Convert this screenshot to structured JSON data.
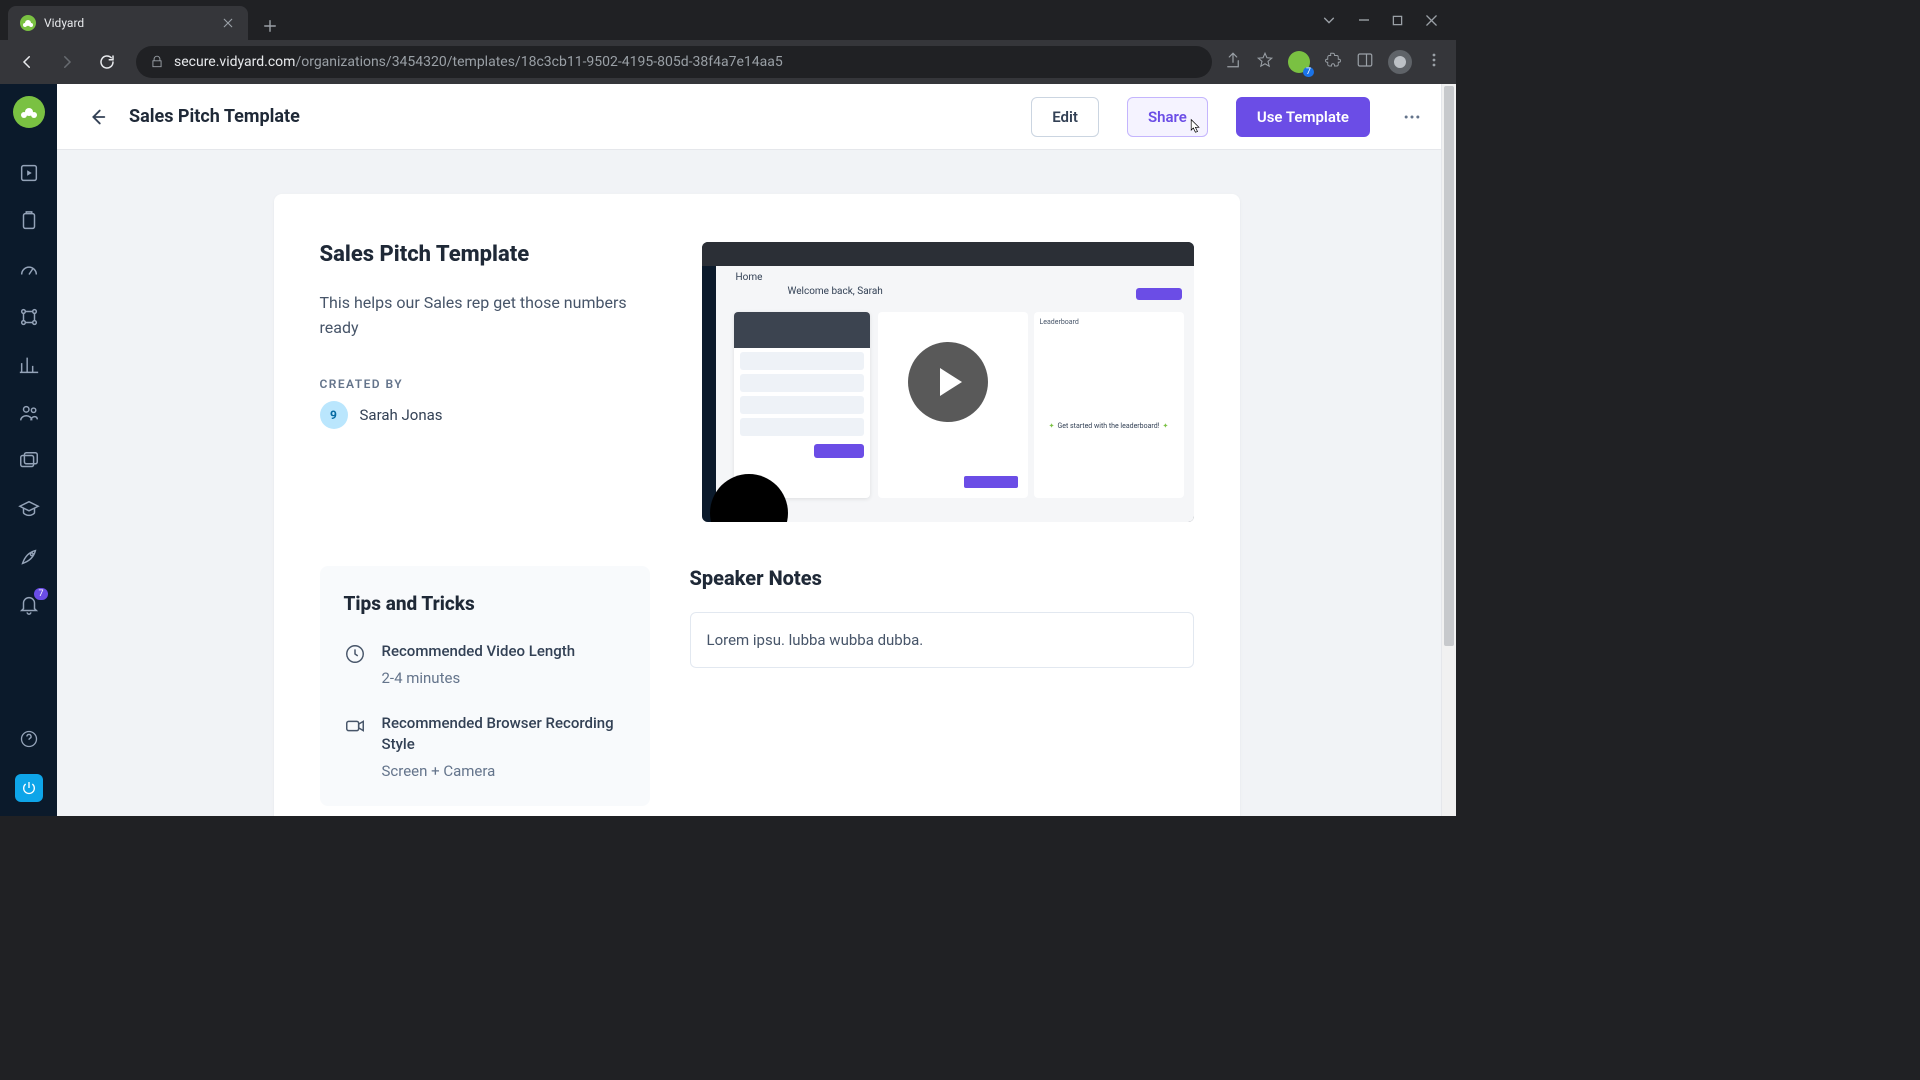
{
  "browser": {
    "tab_title": "Vidyard",
    "url_host": "secure.vidyard.com",
    "url_path": "/organizations/3454320/templates/18c3cb11-9502-4195-805d-38f4a7e14aa5",
    "ext_badge": "7"
  },
  "header": {
    "title": "Sales Pitch Template",
    "edit": "Edit",
    "share": "Share",
    "use_template": "Use Template"
  },
  "rail": {
    "bell_badge": "7"
  },
  "template": {
    "title": "Sales Pitch Template",
    "description": "This helps our Sales rep get those numbers ready",
    "created_by_label": "CREATED BY",
    "creator_initial": "9",
    "creator_name": "Sarah Jonas"
  },
  "thumbnail": {
    "home_label": "Home",
    "welcome": "Welcome back, Sarah",
    "leaderboard": "Leaderboard",
    "get_started": "Get started with the leaderboard!"
  },
  "tips": {
    "heading": "Tips and Tricks",
    "items": [
      {
        "label": "Recommended Video Length",
        "value": "2-4 minutes"
      },
      {
        "label": "Recommended Browser Recording Style",
        "value": "Screen + Camera"
      }
    ]
  },
  "notes": {
    "heading": "Speaker Notes",
    "body": "Lorem ipsu. lubba wubba dubba."
  }
}
